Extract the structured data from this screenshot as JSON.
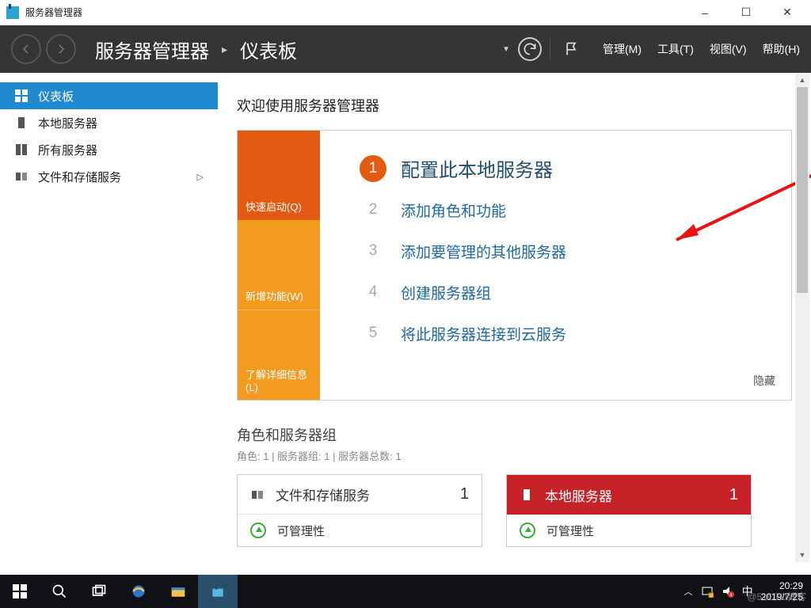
{
  "window": {
    "title": "服务器管理器"
  },
  "header": {
    "breadcrumb": {
      "app": "服务器管理器",
      "page": "仪表板"
    },
    "menus": {
      "manage": "管理(M)",
      "tools": "工具(T)",
      "view": "视图(V)",
      "help": "帮助(H)"
    }
  },
  "sidebar": {
    "items": [
      {
        "label": "仪表板"
      },
      {
        "label": "本地服务器"
      },
      {
        "label": "所有服务器"
      },
      {
        "label": "文件和存储服务"
      }
    ]
  },
  "main": {
    "welcome": "欢迎使用服务器管理器",
    "tabs": {
      "quick": "快速启动(Q)",
      "new": "新增功能(W)",
      "learn": "了解详细信息(L)"
    },
    "steps": {
      "s1": "配置此本地服务器",
      "s2": "添加角色和功能",
      "s3": "添加要管理的其他服务器",
      "s4": "创建服务器组",
      "s5": "将此服务器连接到云服务"
    },
    "hide": "隐藏",
    "roles": {
      "title": "角色和服务器组",
      "subtitle": "角色: 1 | 服务器组: 1 | 服务器总数: 1",
      "tiles": [
        {
          "title": "文件和存储服务",
          "count": "1",
          "row1": "可管理性"
        },
        {
          "title": "本地服务器",
          "count": "1",
          "row1": "可管理性"
        }
      ]
    }
  },
  "taskbar": {
    "ime": "中",
    "time": "20:29",
    "date": "2019/7/25",
    "watermark": "@51CTO博客"
  }
}
